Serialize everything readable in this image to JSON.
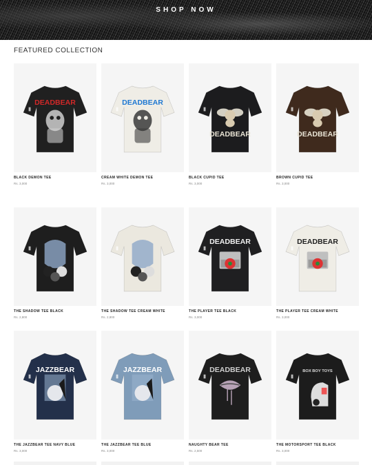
{
  "hero": {
    "button_label": "SHOP NOW"
  },
  "section": {
    "title": "FEATURED COLLECTION"
  },
  "products": [
    {
      "name": "BLACK DEMON TEE",
      "price": "Rs. 3,000",
      "shirt": "#202020",
      "print_text": "DEADBEAR",
      "print_color": "#d22828",
      "graphic": "skull"
    },
    {
      "name": "CREAM WHITE DEMON TEE",
      "price": "Rs. 3,000",
      "shirt": "#efede6",
      "print_text": "DEADBEAR",
      "print_color": "#1e78d2",
      "graphic": "skull"
    },
    {
      "name": "BLACK CUPID TEE",
      "price": "Rs. 3,000",
      "shirt": "#1c1c1e",
      "print_text": "DEADBEAR",
      "print_color": "#e8e3d4",
      "graphic": "cupid"
    },
    {
      "name": "BROWN CUPID TEE",
      "price": "Rs. 3,000",
      "shirt": "#3f2a1d",
      "print_text": "DEADBEAR",
      "print_color": "#e8e3d4",
      "graphic": "cupid"
    },
    {
      "name": "THE SHADOW TEE BLACK",
      "price": "Rs. 2,800",
      "shirt": "#1e1e1e",
      "print_text": "",
      "print_color": "#ffffff",
      "graphic": "shadow"
    },
    {
      "name": "THE SHADOW TEE CREAM WHITE",
      "price": "Rs. 2,800",
      "shirt": "#ebe8df",
      "print_text": "",
      "print_color": "#ffffff",
      "graphic": "shadow"
    },
    {
      "name": "THE PLAYER TEE BLACK",
      "price": "Rs. 3,000",
      "shirt": "#1f1f21",
      "print_text": "DEADBEAR",
      "print_color": "#f1f1f1",
      "graphic": "player"
    },
    {
      "name": "THE PLAYER TEE CREAM WHITE",
      "price": "Rs. 3,000",
      "shirt": "#efede6",
      "print_text": "DEADBEAR",
      "print_color": "#222222",
      "graphic": "player"
    },
    {
      "name": "THE JAZZBEAR TEE NAVY BLUE",
      "price": "Rs. 3,000",
      "shirt": "#23304a",
      "print_text": "JAZZBEAR",
      "print_color": "#ffffff",
      "graphic": "jazz"
    },
    {
      "name": "THE JAZZBEAR TEE BLUE",
      "price": "Rs. 3,000",
      "shirt": "#7f9cb9",
      "print_text": "JAZZBEAR",
      "print_color": "#ffffff",
      "graphic": "jazz"
    },
    {
      "name": "NAUGHTY BEAR TEE",
      "price": "Rs. 2,500",
      "shirt": "#1e1e1e",
      "print_text": "DEADBEAR",
      "print_color": "#cfcfcf",
      "graphic": "lips"
    },
    {
      "name": "THE MOTORSPORT TEE BLACK",
      "price": "Rs. 3,000",
      "shirt": "#1c1c1c",
      "print_text": "BOX BOY TOYS",
      "print_color": "#dddddd",
      "graphic": "car"
    }
  ]
}
